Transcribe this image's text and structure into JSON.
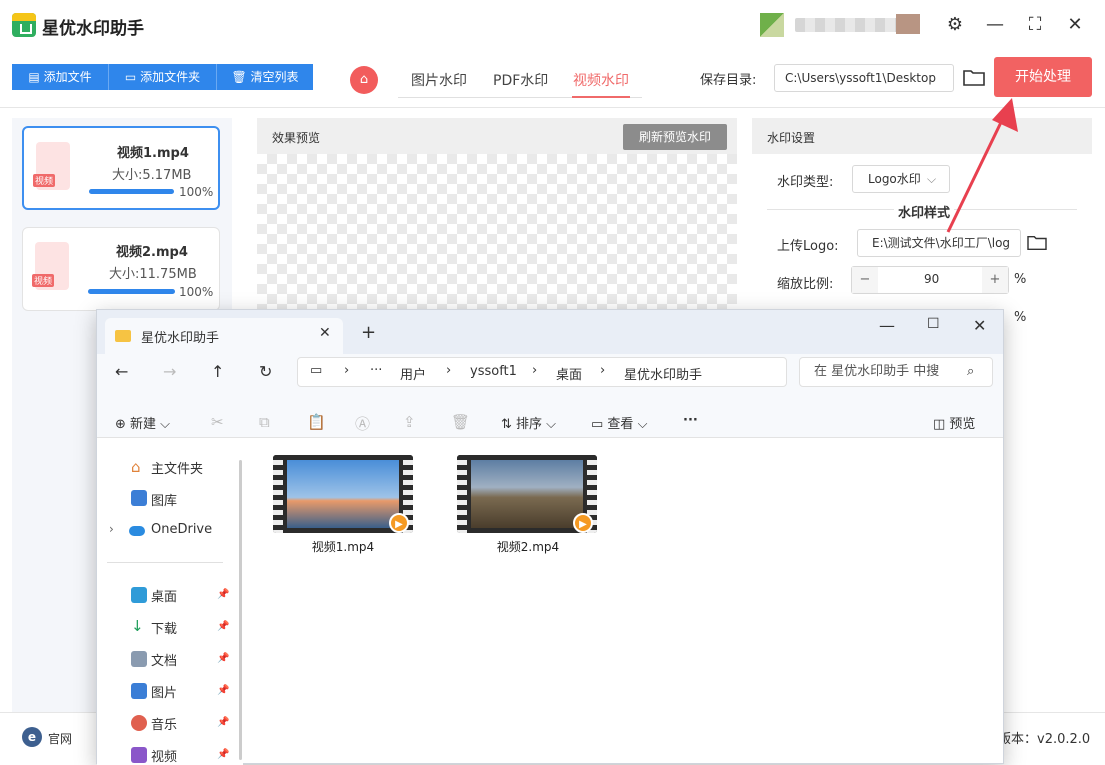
{
  "app": {
    "title": "星优水印助手"
  },
  "window_controls": {
    "settings": "⚙",
    "minimize": "—",
    "maximize": "⛶",
    "close": "✕"
  },
  "toolbar": {
    "add_file": "添加文件",
    "add_folder": "添加文件夹",
    "clear_list": "清空列表"
  },
  "tabs": [
    {
      "label": "图片水印"
    },
    {
      "label": "PDF水印"
    },
    {
      "label": "视频水印",
      "active": true
    }
  ],
  "save": {
    "label": "保存目录:",
    "path": "C:\\Users\\yssoft1\\Desktop",
    "start_label": "开始处理"
  },
  "files": [
    {
      "name": "视频1.mp4",
      "size": "大小:5.17MB",
      "progress_pct": "100%",
      "progress": 1.0,
      "tag": "视频"
    },
    {
      "name": "视频2.mp4",
      "size": "大小:11.75MB",
      "progress_pct": "100%",
      "progress": 1.0,
      "tag": "视频"
    }
  ],
  "preview": {
    "label": "效果预览",
    "refresh_label": "刷新预览水印"
  },
  "settings": {
    "label": "水印设置",
    "type_label": "水印类型:",
    "type_value": "Logo水印",
    "style_title": "水印样式",
    "upload_label": "上传Logo:",
    "upload_path": "E:\\测试文件\\水印工厂\\log",
    "scale_label": "缩放比例:",
    "scale_value": "90",
    "percent": "%"
  },
  "statusbar": {
    "official": "官网",
    "version": "版本：v2.0.2.0"
  },
  "explorer": {
    "tab_title": "星优水印助手",
    "breadcrumb": [
      "用户",
      "yssoft1",
      "桌面",
      "星优水印助手"
    ],
    "search_placeholder": "在 星优水印助手 中搜",
    "commands": {
      "new": "新建",
      "sort": "排序",
      "view": "查看",
      "preview": "预览",
      "more": "···"
    },
    "nav": [
      {
        "label": "主文件夹",
        "icon": "home-icon"
      },
      {
        "label": "图库",
        "icon": "gallery-icon"
      },
      {
        "label": "OneDrive",
        "icon": "onedrive-icon"
      },
      {
        "label": "桌面",
        "icon": "desktop-icon"
      },
      {
        "label": "下载",
        "icon": "download-icon"
      },
      {
        "label": "文档",
        "icon": "document-icon"
      },
      {
        "label": "图片",
        "icon": "pictures-icon"
      },
      {
        "label": "音乐",
        "icon": "music-icon"
      },
      {
        "label": "视频",
        "icon": "video-icon"
      }
    ],
    "files": [
      {
        "name": "视频1.mp4"
      },
      {
        "name": "视频2.mp4"
      }
    ]
  },
  "colors": {
    "accent": "#2f86eb",
    "start": "#f26262",
    "active_tab": "#f06a6a"
  }
}
